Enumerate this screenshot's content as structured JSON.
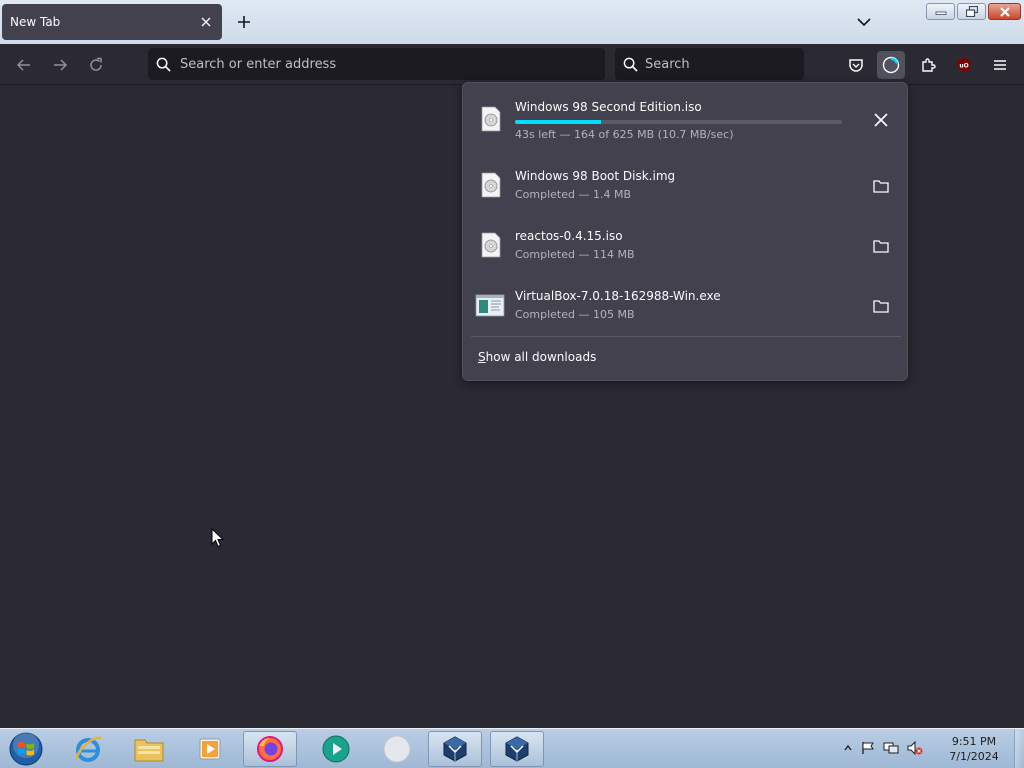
{
  "browser": {
    "tab": {
      "title": "New Tab"
    },
    "urlbar": {
      "placeholder": "Search or enter address"
    },
    "searchbar": {
      "placeholder": "Search"
    }
  },
  "downloads": {
    "items": [
      {
        "name": "Windows 98 Second Edition.iso",
        "status": "43s left — 164 of 625 MB (10.7 MB/sec)",
        "progress_fraction": 0.262,
        "icon": "disc-image-file-icon",
        "action": "cancel"
      },
      {
        "name": "Windows 98 Boot Disk.img",
        "status": "Completed — 1.4 MB",
        "icon": "disc-image-file-icon",
        "action": "show-in-folder"
      },
      {
        "name": "reactos-0.4.15.iso",
        "status": "Completed — 114 MB",
        "icon": "disc-image-file-icon",
        "action": "show-in-folder"
      },
      {
        "name": "VirtualBox-7.0.18-162988-Win.exe",
        "status": "Completed — 105 MB",
        "icon": "installer-file-icon",
        "action": "show-in-folder"
      }
    ],
    "show_all": {
      "first": "S",
      "rest": "how all downloads"
    }
  },
  "taskbar": {
    "apps": [
      "start-orb",
      "internet-explorer",
      "file-explorer",
      "media-player",
      "firefox",
      "media-app",
      "blank-app",
      "virtualbox",
      "virtualbox"
    ],
    "clock": {
      "time": "9:51 PM",
      "date": "7/1/2024"
    }
  },
  "colors": {
    "accent_progress": "#00ddff",
    "panel_bg": "#42414d",
    "toolbar_bg": "#2b2a33",
    "content_bg": "#2b2a33"
  }
}
